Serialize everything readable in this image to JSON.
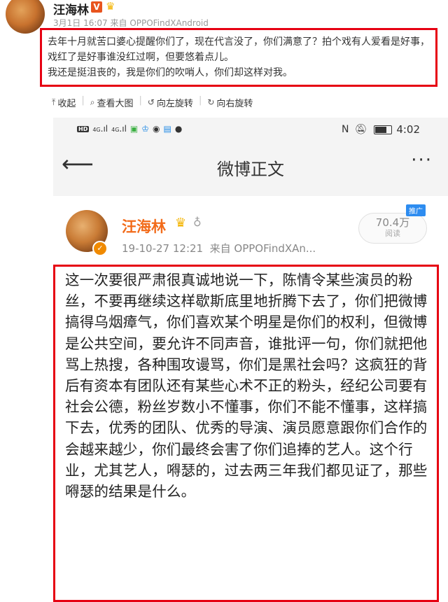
{
  "outer_post": {
    "author": "汪海林",
    "verified_badge": "V",
    "time": "3月1日 16:07",
    "source": "来自 OPPOFindXAndroid",
    "text_line1": "去年十月就苦口婆心提醒你们了，现在代言没了，你们满意了？拍个戏有人爱看是好事，戏红了是好事谁没红过啊，但要悠着点儿。",
    "text_line2": "我还是挺沮丧的，我是你们的吹哨人，你们却这样对我。",
    "toolbar": {
      "collapse": "收起",
      "view_large": "查看大图",
      "rotate_left": "向左旋转",
      "rotate_right": "向右旋转"
    }
  },
  "phone": {
    "status_bar": {
      "time": "4:02",
      "hd_label": "HD",
      "signal_label1": "4G",
      "signal_label2": "4G"
    },
    "nav": {
      "title": "微博正文"
    },
    "post": {
      "author": "汪海林",
      "time": "19-10-27 12:21",
      "source": "来自 OPPOFindXAn...",
      "read_count": "70.4万",
      "read_label": "阅读",
      "promo_label": "推广",
      "body": "这一次要很严肃很真诚地说一下，陈情令某些演员的粉丝，不要再继续这样歇斯底里地折腾下去了，你们把微博搞得乌烟瘴气，你们喜欢某个明星是你们的权利，但微博是公共空间，要允许不同声音，谁批评一句，你们就把他骂上热搜，各种围攻谩骂，你们是黑社会吗？这疯狂的背后有资本有团队还有某些心术不正的粉头，经纪公司要有社会公德，粉丝岁数小不懂事，你们不能不懂事，这样搞下去，优秀的团队、优秀的导演、演员愿意跟你们合作的会越来越少，你们最终会害了你们追捧的艺人。这个行业，尤其艺人，嘚瑟的，过去两三年我们都见证了，那些嘚瑟的结果是什么。"
    }
  },
  "colors": {
    "highlight_border": "#e60012",
    "author_orange": "#f26b1a",
    "promo_blue": "#2d8cf0"
  }
}
